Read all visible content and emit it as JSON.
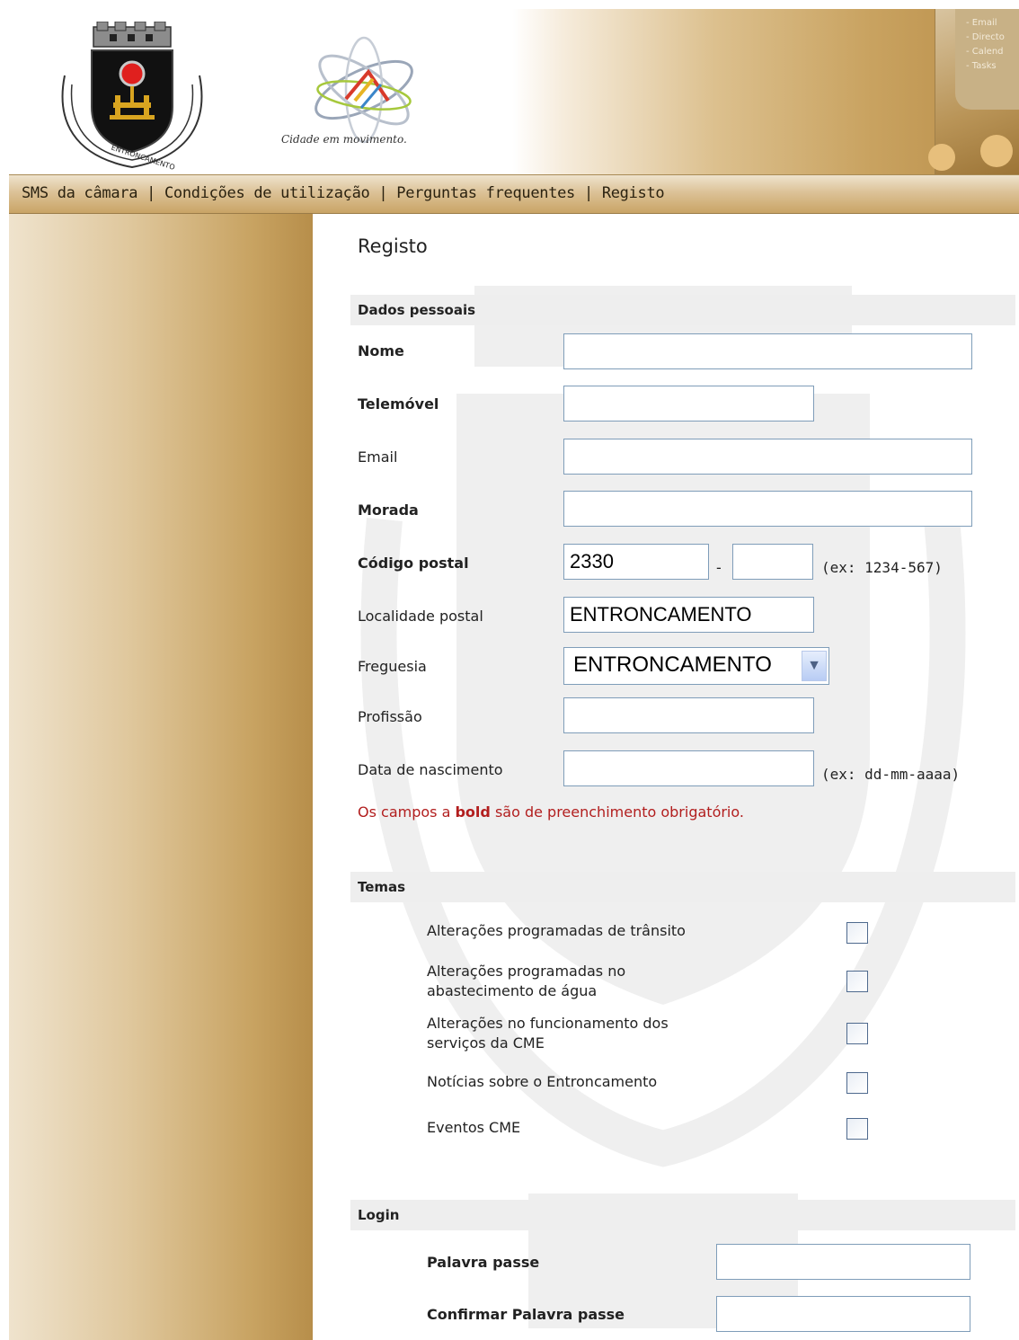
{
  "header": {
    "tagline": "Cidade em movimento.",
    "crest_text": "ENTRONCAMENTO",
    "device_menu": [
      "- Email",
      "- Directo",
      "- Calend",
      "- Tasks"
    ]
  },
  "nav": {
    "items": [
      "SMS da câmara",
      "Condições de utilização",
      "Perguntas frequentes",
      "Registo"
    ],
    "separator": "|"
  },
  "page": {
    "title": "Registo"
  },
  "sections": {
    "personal": "Dados pessoais",
    "themes": "Temas",
    "login": "Login"
  },
  "fields": {
    "nome": {
      "label": "Nome",
      "value": ""
    },
    "telemovel": {
      "label": "Telemóvel",
      "value": ""
    },
    "email": {
      "label": "Email",
      "value": ""
    },
    "morada": {
      "label": "Morada",
      "value": ""
    },
    "codigo_postal": {
      "label": "Código postal",
      "part1": "2330",
      "part2": "",
      "separator": "-",
      "hint": "(ex: 1234-567)"
    },
    "localidade": {
      "label": "Localidade postal",
      "value": "ENTRONCAMENTO"
    },
    "freguesia": {
      "label": "Freguesia",
      "value": "ENTRONCAMENTO"
    },
    "profissao": {
      "label": "Profissão",
      "value": ""
    },
    "data_nascimento": {
      "label": "Data de nascimento",
      "value": "",
      "hint": "(ex: dd-mm-aaaa)"
    }
  },
  "required_note": {
    "before": "Os campos a ",
    "bold": "bold",
    "after": " são de preenchimento obrigatório."
  },
  "themes": [
    {
      "line1": "Alterações programadas de trânsito",
      "line2": "",
      "checked": false
    },
    {
      "line1": "Alterações programadas no",
      "line2": "abastecimento de água",
      "checked": false
    },
    {
      "line1": "Alterações no funcionamento dos",
      "line2": "serviços da CME",
      "checked": false
    },
    {
      "line1": "Notícias sobre o Entroncamento",
      "line2": "",
      "checked": false
    },
    {
      "line1": "Eventos CME",
      "line2": "",
      "checked": false
    }
  ],
  "login": {
    "password_label": "Palavra passe",
    "confirm_label": "Confirmar Palavra passe"
  },
  "colors": {
    "required_note": "#b21e1e",
    "input_border": "#7f9db9",
    "section_bar": "#eeeeee",
    "sidebar_gold": "#b78e4a"
  }
}
